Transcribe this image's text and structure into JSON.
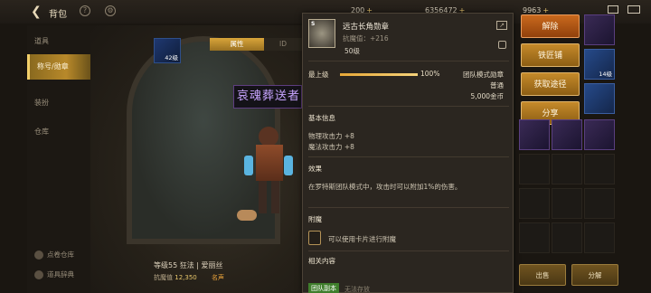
{
  "topbar": {
    "back_icon": "back-arrow-icon",
    "title": "背包",
    "currency1": "200",
    "currency2": "6356472",
    "currency3": "9963"
  },
  "leftnav": {
    "items": [
      {
        "label": "道具"
      },
      {
        "label": "称号/勋章"
      },
      {
        "label": "装扮"
      },
      {
        "label": "仓库"
      }
    ],
    "footer": [
      {
        "label": "点卷仓库"
      },
      {
        "label": "道具辞典"
      }
    ]
  },
  "center": {
    "tab_active": "属性",
    "tab_other": "ID",
    "slot_level": "42级",
    "banner_text": "哀魂葬送者",
    "char_info": "等级55 狂法 | 爱丽丝",
    "char_stat_label": "抗魔值",
    "char_stat_value": "12,350",
    "extra": "名声"
  },
  "panel": {
    "item_name": "远古长角勋章",
    "item_badge": "S",
    "resist_label": "抗魔值：+216",
    "level": "50级",
    "max_label": "最上级",
    "progress_pct": "100%",
    "progress_value": 1.0,
    "mode": "团队模式勋章",
    "grade": "普通",
    "price": "5,000金币",
    "basic_info_title": "基本信息",
    "stat1": "物理攻击力 +8",
    "stat2": "魔法攻击力 +8",
    "effect_title": "效果",
    "effect_text": "在罗特斯团队模式中，攻击时可以附加1%的伤害。",
    "enchant_title": "附魔",
    "enchant_text": "可以使用卡片进行附魔",
    "related_title": "相关内容",
    "related_tag": "团队副本",
    "related_text": "无法存放"
  },
  "actions": {
    "dismantle": "解除",
    "smith": "铁匠铺",
    "obtain": "获取途径",
    "share": "分享"
  },
  "inventory": {
    "slot_levels": [
      "14级"
    ],
    "sell_label": "出售",
    "decompose_label": "分解"
  }
}
